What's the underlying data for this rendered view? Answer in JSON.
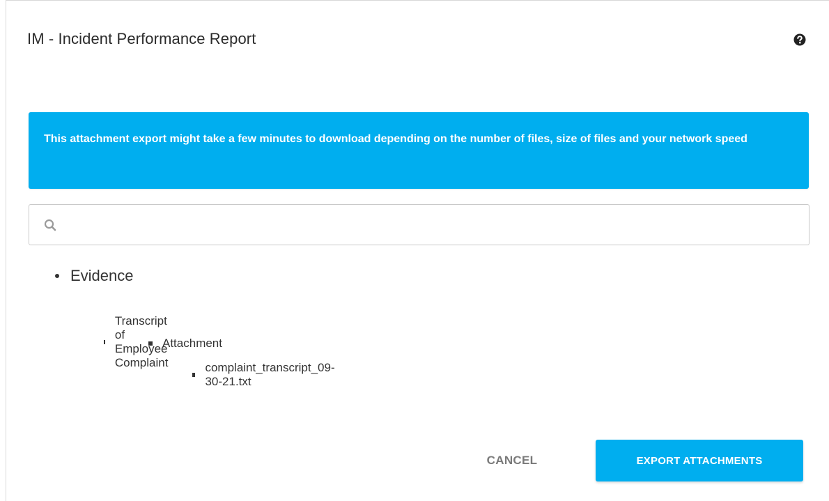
{
  "dialog": {
    "title": "IM - Incident Performance Report",
    "help_icon": "question-circle-icon"
  },
  "banner": {
    "text": "This attachment export might take a few minutes to download depending on the number of files, size of files and your network speed",
    "color": "#00aeef"
  },
  "search": {
    "icon": "search-icon",
    "value": "",
    "placeholder": ""
  },
  "tree": {
    "root": "Evidence",
    "child": "Transcript of Employee Complaint",
    "grandchild": "Attachment",
    "file": "complaint_transcript_09-30-21.txt"
  },
  "actions": {
    "cancel_label": "CANCEL",
    "export_label": "EXPORT ATTACHMENTS"
  }
}
